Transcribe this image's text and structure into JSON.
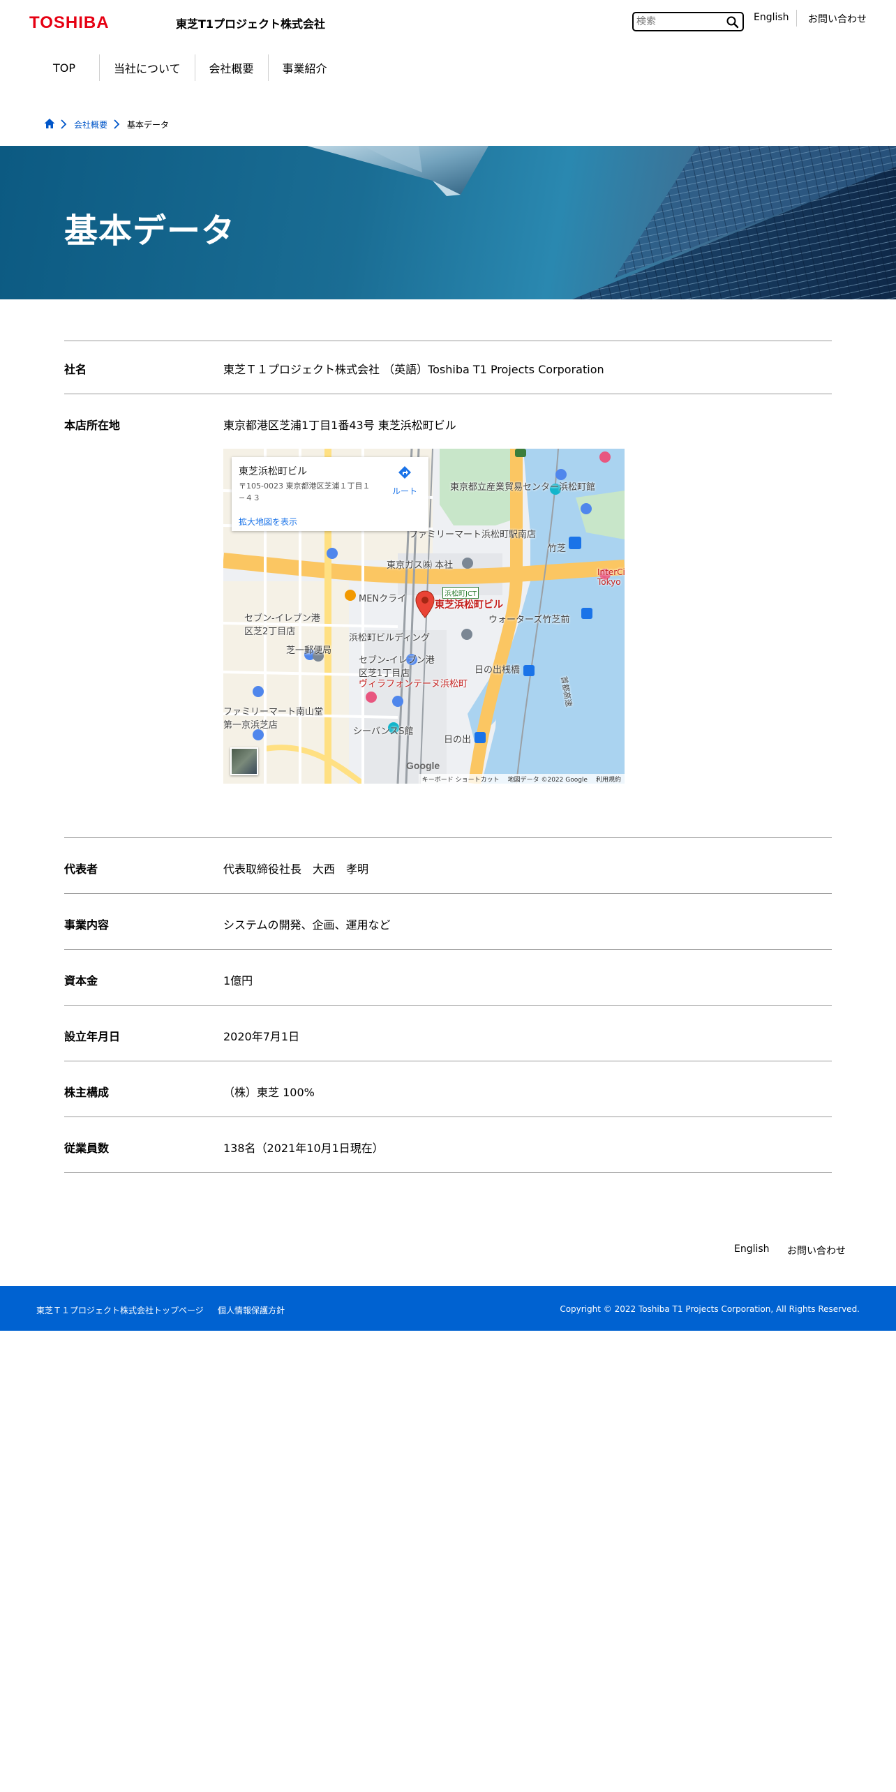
{
  "header": {
    "logo": "TOSHIBA",
    "site_name": "東芝T1プロジェクト株式会社",
    "search_placeholder": "検索",
    "english": "English",
    "contact": "お問い合わせ"
  },
  "nav": {
    "items": [
      "TOP",
      "当社について",
      "会社概要",
      "事業紹介"
    ]
  },
  "breadcrumb": {
    "parent": "会社概要",
    "current": "基本データ"
  },
  "hero": {
    "title": "基本データ"
  },
  "rows": [
    {
      "label": "社名",
      "value": "東芝Ｔ１プロジェクト株式会社 （英語）Toshiba T1 Projects Corporation"
    },
    {
      "label": "本店所在地",
      "value": "東京都港区芝浦1丁目1番43号 東芝浜松町ビル"
    },
    {
      "label": "代表者",
      "value": "代表取締役社長　大西　孝明"
    },
    {
      "label": "事業内容",
      "value": "システムの開発、企画、運用など"
    },
    {
      "label": "資本金",
      "value": "1億円"
    },
    {
      "label": "設立年月日",
      "value": "2020年7月1日"
    },
    {
      "label": "株主構成",
      "value": "（株）東芝 100%"
    },
    {
      "label": "従業員数",
      "value": "138名（2021年10月1日現在）"
    }
  ],
  "map": {
    "card_title": "東芝浜松町ビル",
    "card_address": "〒105-0023 東京都港区芝浦１丁目１−４３",
    "card_link": "拡大地図を表示",
    "route": "ルート",
    "pin_label": "東芝浜松町ビル",
    "google": "Google",
    "shortcuts": "キーボード ショートカット",
    "data_credit": "地図データ ©2022 Google",
    "terms": "利用規約",
    "labels": [
      "東京都立産業貿易センター浜松町館",
      "ファミリーマート浜松町駅南店",
      "東京ガス㈱ 本社",
      "竹芝",
      "MENクライ",
      "浜松町ビルディング",
      "ウォーターズ竹芝前",
      "セブン-イレブン港区芝2丁目店",
      "芝一郵便局",
      "セブン-イレブン港区芝1丁目店",
      "ヴィラフォンテーヌ浜松町",
      "日の出桟橋",
      "ファミリーマート南山堂第一京浜芝店",
      "シーバンスS館",
      "日の出",
      "首都高速",
      "InterCity Tokyo",
      "浜松町JCT"
    ]
  },
  "footer": {
    "english": "English",
    "contact": "お問い合わせ",
    "top_page": "東芝Ｔ１プロジェクト株式会社トップページ",
    "privacy": "個人情報保護方針",
    "copyright": "Copyright © 2022 Toshiba T1 Projects Corporation, All Rights Reserved."
  },
  "colors": {
    "brand_red": "#e60012",
    "link_blue": "#0056c9",
    "footer_blue": "#0062d1",
    "hero_blue": "#1a6d94"
  }
}
